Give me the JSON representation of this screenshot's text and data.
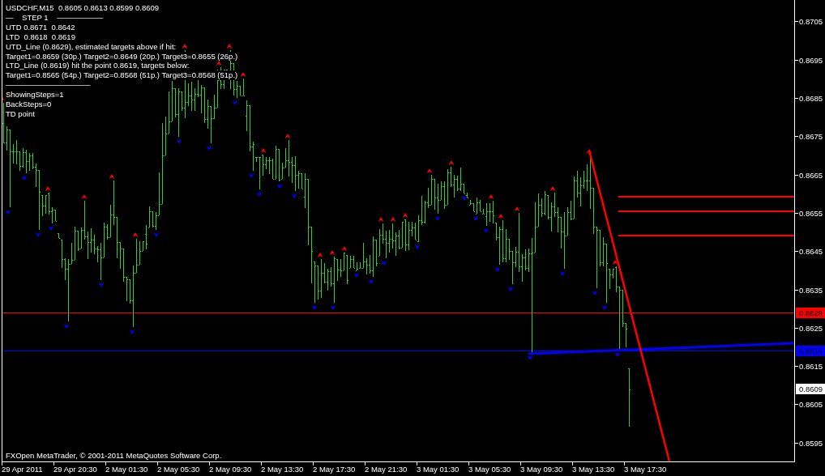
{
  "chart": {
    "quote_line": "USDCHF,M15  0.8605 0.8613 0.8599 0.8609",
    "indicator_lines": [
      "—    STEP 1    ——————",
      "UTD 0.8671  0.8642",
      "LTD  0.8618  0.8619",
      "UTD_Line (0.8629), estimated targets above if hit:",
      "Target1=0.8659 (30p.) Target2=0.8649 (20p.) Target3=0.8655 (26p.)",
      "LTD_Line (0.8619) hit the point 0.8619, targets below:",
      "Target1=0.8565 (54p.) Target2=0.8568 (51p.) Target3=0.8568 (51p.)",
      "———————————",
      "ShowingSteps=1",
      "BackSteps=0",
      "TD point"
    ],
    "copyright": "FXOpen MetaTrader, © 2001-2011 MetaQuotes Software Corp."
  },
  "price_axis": {
    "labels": [
      "0.8705",
      "0.8695",
      "0.8685",
      "0.8675",
      "0.8665",
      "0.8655",
      "0.8645",
      "0.8635",
      "0.8625",
      "0.8615",
      "0.8605",
      "0.8595"
    ]
  },
  "price_markers": [
    {
      "label": "0.8629",
      "color": "#ff0000"
    },
    {
      "label": "0.8619",
      "color": "#0000ff"
    },
    {
      "label": "0.8609",
      "color": "#ffffff"
    }
  ],
  "time_axis": {
    "labels": [
      "29 Apr 2011",
      "29 Apr 20:30",
      "2 May 01:30",
      "2 May 05:30",
      "2 May 09:30",
      "2 May 13:30",
      "2 May 17:30",
      "2 May 21:30",
      "3 May 01:30",
      "3 May 05:30",
      "3 May 09:30",
      "3 May 13:30",
      "3 May 17:30"
    ]
  }
}
